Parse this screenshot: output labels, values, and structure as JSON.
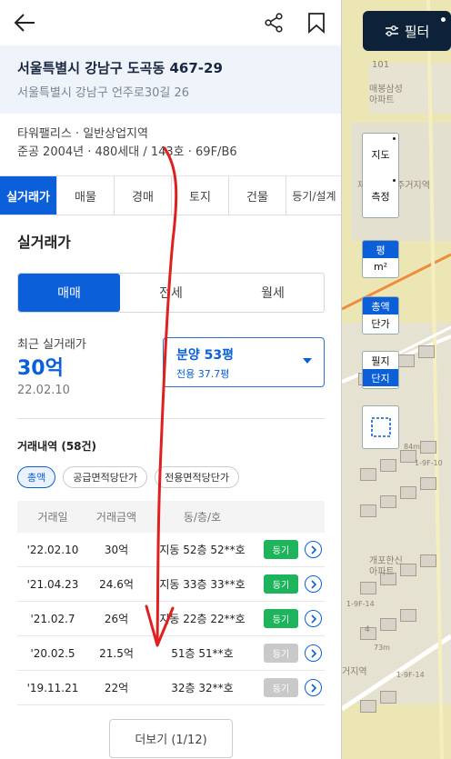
{
  "map": {
    "filter_label": "필터",
    "controls": [
      {
        "top": "지도",
        "bottom": "측정"
      },
      {
        "top": "평",
        "bottom": "m²"
      },
      {
        "top": "총액",
        "bottom": "단가"
      },
      {
        "top": "필지",
        "bottom": "단지"
      }
    ],
    "labels": {
      "building_number": "101",
      "apt_name": "매봉삼성\n아파트",
      "zone_label": "제3종일반주거지역",
      "apt_name2": "개포한신\n아파트",
      "zone_label2": "거지역",
      "dist": "84m",
      "lot1": "1-9F-10",
      "lot2": "1-9F-14",
      "lot3": "4",
      "lot4": "73m",
      "lot5": "1-9F-14"
    }
  },
  "header": {
    "address_main": "서울특별시 강남구 도곡동 467-29",
    "address_sub": "서울특별시 강남구 언주로30길 26"
  },
  "info": {
    "line1": "타워팰리스 · 일반상업지역",
    "line2": "준공 2004년 · 480세대 / 143호 · 69F/B6"
  },
  "tabs": [
    "실거래가",
    "매물",
    "경매",
    "토지",
    "건물",
    "등기/설계"
  ],
  "section_title": "실거래가",
  "segments": [
    "매매",
    "전세",
    "월세"
  ],
  "recent": {
    "label": "최근 실거래가",
    "price": "30억",
    "date": "22.02.10",
    "area_main": "분양 53평",
    "area_sub": "전용 37.7평"
  },
  "history": {
    "title": "거래내역 (58건)",
    "chips": [
      "총액",
      "공급면적당단가",
      "전용면적당단가"
    ],
    "columns": [
      "거래일",
      "거래금액",
      "동/층/호"
    ],
    "rows": [
      {
        "date": "'22.02.10",
        "amount": "30억",
        "unit": "지동 52층 52**호",
        "badge": "등기",
        "registered": true
      },
      {
        "date": "'21.04.23",
        "amount": "24.6억",
        "unit": "지동 33층 33**호",
        "badge": "등기",
        "registered": true
      },
      {
        "date": "'21.02.7",
        "amount": "26억",
        "unit": "지동 22층 22**호",
        "badge": "등기",
        "registered": true
      },
      {
        "date": "'20.02.5",
        "amount": "21.5억",
        "unit": "51층 51**호",
        "badge": "등기",
        "registered": false
      },
      {
        "date": "'19.11.21",
        "amount": "22억",
        "unit": "32층 32**호",
        "badge": "등기",
        "registered": false
      }
    ]
  },
  "more_label": "더보기 (1/12)",
  "colors": {
    "accent": "#0b5fd9",
    "green": "#1db45c",
    "navy": "#0d2238",
    "arrow": "#e02020"
  }
}
